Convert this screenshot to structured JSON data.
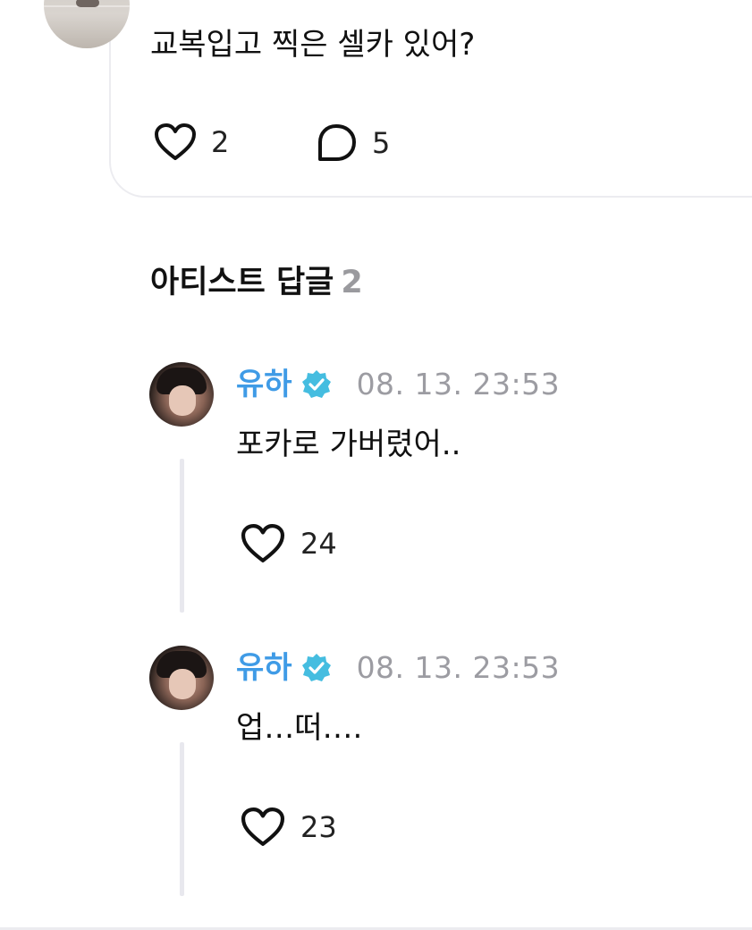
{
  "post": {
    "text": "교복입고 찍은 셀카 있어?",
    "like_count": "2",
    "comment_count": "5",
    "icons": {
      "like": "heart-outline-icon",
      "comment": "speech-bubble-icon"
    }
  },
  "artist_replies": {
    "title": "아티스트 답글",
    "count": "2",
    "items": [
      {
        "name": "유하",
        "verified": true,
        "time": "08. 13. 23:53",
        "text": "포카로 가버렸어..",
        "like_count": "24"
      },
      {
        "name": "유하",
        "verified": true,
        "time": "08. 13. 23:53",
        "text": "업…떠….",
        "like_count": "23"
      }
    ]
  },
  "colors": {
    "name_accent": "#3f9be6",
    "verified_badge": "#45bde0",
    "muted_text": "#9c9ca2",
    "divider": "#ececf0"
  }
}
